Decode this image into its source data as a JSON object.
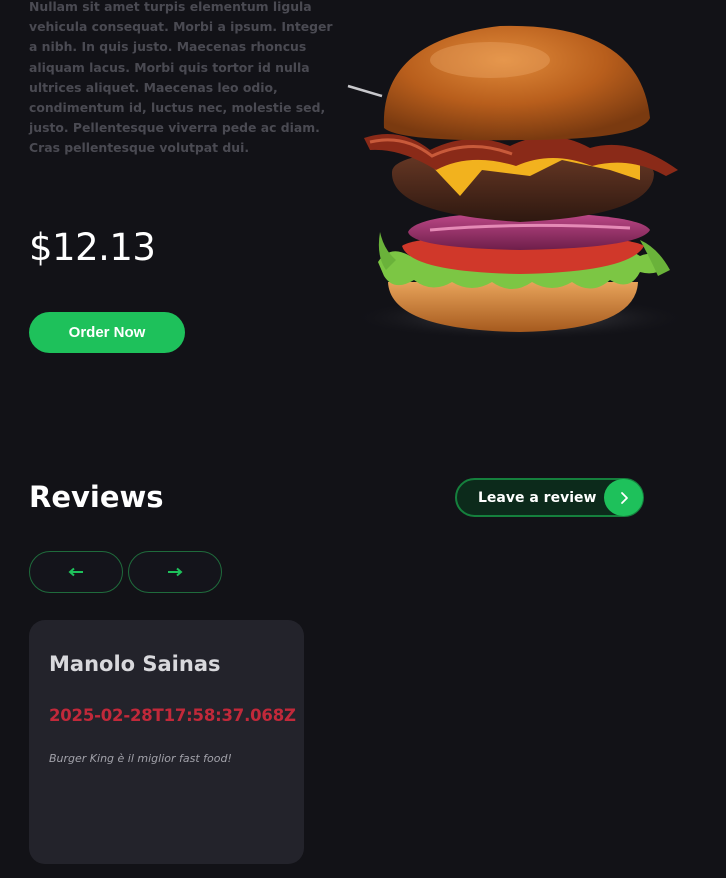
{
  "product": {
    "description": "Nullam sit amet turpis elementum ligula vehicula consequat. Morbi a ipsum. Integer a nibh. In quis justo. Maecenas rhoncus aliquam lacus. Morbi quis tortor id nulla ultrices aliquet. Maecenas leo odio, condimentum id, luctus nec, molestie sed, justo. Pellentesque viverra pede ac diam. Cras pellentesque volutpat dui.",
    "price": "$12.13",
    "order_label": "Order Now",
    "image_icon": "burger-image"
  },
  "reviews": {
    "title": "Reviews",
    "leave_label": "Leave a review",
    "prev_icon": "arrow-left-icon",
    "next_icon": "arrow-right-icon",
    "items": [
      {
        "name": "Manolo Sainas",
        "date": "2025-02-28T17:58:37.068Z",
        "text": "Burger King è il miglior fast food!"
      }
    ]
  },
  "colors": {
    "background": "#121217",
    "accent": "#1ec15b",
    "card": "#23232b",
    "date": "#c1293a"
  }
}
